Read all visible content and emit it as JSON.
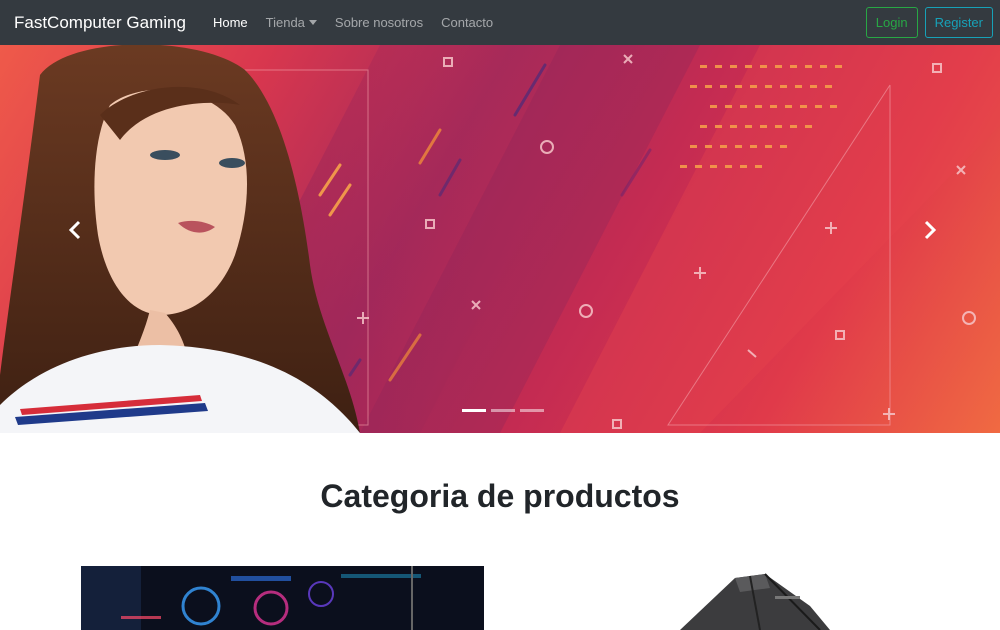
{
  "navbar": {
    "brand": "FastComputer Gaming",
    "links": [
      {
        "label": "Home",
        "active": true
      },
      {
        "label": "Tienda",
        "dropdown": true
      },
      {
        "label": "Sobre nosotros"
      },
      {
        "label": "Contacto"
      }
    ],
    "login_label": "Login",
    "register_label": "Register"
  },
  "carousel": {
    "prev_icon": "chevron-left-icon",
    "next_icon": "chevron-right-icon",
    "slide_count": 3,
    "active_slide": 1
  },
  "section": {
    "title": "Categoria de productos"
  },
  "colors": {
    "navbar_bg": "#343a40",
    "login": "#28a745",
    "register": "#17a2b8"
  }
}
